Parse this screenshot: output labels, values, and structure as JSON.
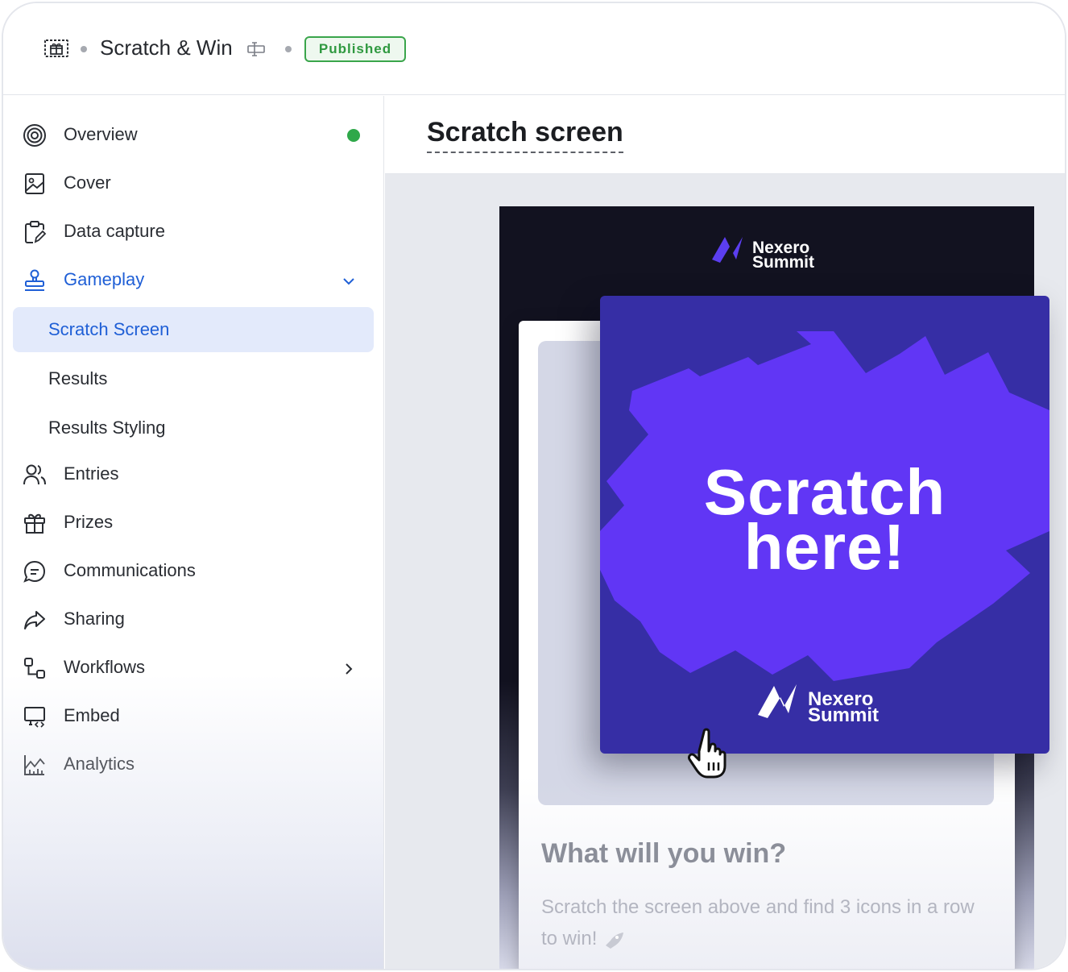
{
  "header": {
    "app_icon": "gift-ticket-icon",
    "title": "Scratch & Win",
    "rename_icon": "rename-icon",
    "status": "Published"
  },
  "sidebar": {
    "items": [
      {
        "label": "Overview",
        "icon": "target-icon",
        "status_dot_color": "#2fa84a"
      },
      {
        "label": "Cover",
        "icon": "image-icon"
      },
      {
        "label": "Data capture",
        "icon": "clipboard-edit-icon"
      },
      {
        "label": "Gameplay",
        "icon": "stamp-icon",
        "expanded": true
      },
      {
        "label": "Entries",
        "icon": "users-icon"
      },
      {
        "label": "Prizes",
        "icon": "gift-icon"
      },
      {
        "label": "Communications",
        "icon": "chat-icon"
      },
      {
        "label": "Sharing",
        "icon": "share-icon"
      },
      {
        "label": "Workflows",
        "icon": "workflow-icon"
      },
      {
        "label": "Embed",
        "icon": "embed-monitor-icon"
      },
      {
        "label": "Analytics",
        "icon": "chart-icon"
      }
    ],
    "gameplay_subitems": [
      {
        "label": "Scratch Screen",
        "selected": true
      },
      {
        "label": "Results"
      },
      {
        "label": "Results Styling"
      }
    ]
  },
  "main": {
    "page_title": "Scratch screen",
    "preview": {
      "brand_line1": "Nexero",
      "brand_line2": "Summit",
      "scratch_line1": "Scratch",
      "scratch_line2": "here!",
      "win_title": "What will you win?",
      "win_description": "Scratch the screen above and find 3 icons in a row to win!",
      "colors": {
        "accent": "#6136f5",
        "card_bg": "#362ea5",
        "phone_bg": "#121220"
      }
    }
  },
  "colors": {
    "active": "#1f5fd6",
    "published": "#2f9940"
  }
}
